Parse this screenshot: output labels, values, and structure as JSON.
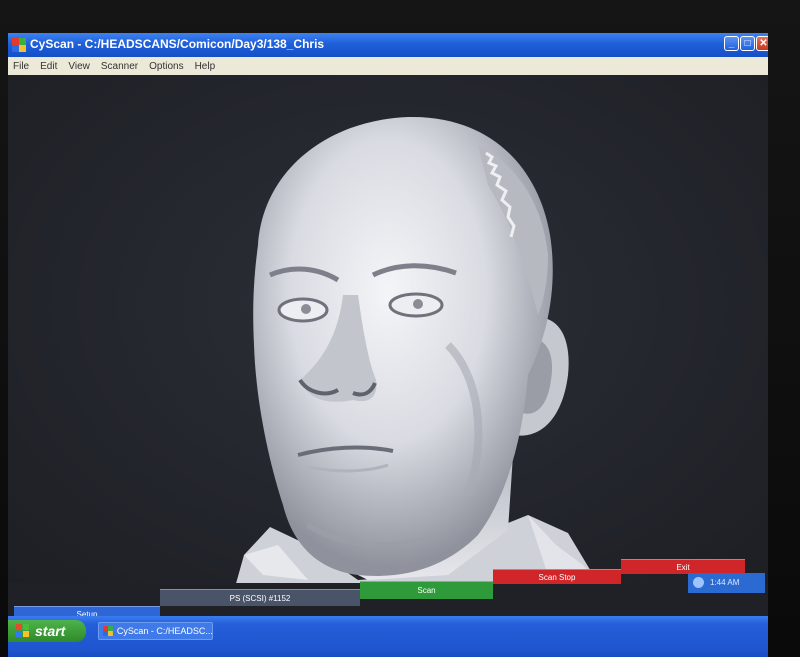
{
  "window": {
    "title": "CyScan - C:/HEADSCANS/Comicon/Day3/138_Chris",
    "app_icon": "cyscan-app-icon",
    "controls": {
      "minimize": "_",
      "maximize": "□",
      "close": "✕"
    }
  },
  "menu": {
    "items": [
      {
        "label": "File"
      },
      {
        "label": "Edit"
      },
      {
        "label": "View"
      },
      {
        "label": "Scanner"
      },
      {
        "label": "Options"
      },
      {
        "label": "Help"
      }
    ]
  },
  "viewport": {
    "content": "3d-head-scan-render"
  },
  "controls": {
    "setup": {
      "label": "Setup",
      "color": "#2f66d6"
    },
    "port": {
      "label": "PS (SCSI) #1152",
      "color": "#4a5468"
    },
    "scan": {
      "label": "Scan",
      "color": "#2e9a3a"
    },
    "scan_stop": {
      "label": "Scan Stop",
      "color": "#d0262a"
    },
    "exit": {
      "label": "Exit",
      "color": "#d0262a"
    }
  },
  "tray": {
    "time": "1:44 AM"
  },
  "taskbar": {
    "start_label": "start",
    "task_label": "CyScan - C:/HEADSC..."
  },
  "colors": {
    "titlebar": "#1f5fd8",
    "menubar": "#ece9d8",
    "viewport_bg": "#23252c",
    "mesh": "#dfe0e6"
  }
}
